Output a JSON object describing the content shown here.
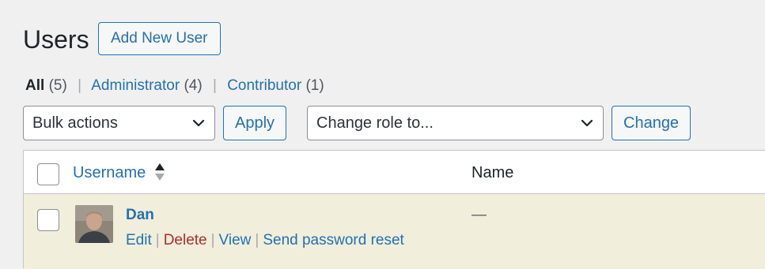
{
  "page": {
    "title": "Users",
    "add_new_label": "Add New User"
  },
  "filters": [
    {
      "label": "All",
      "count": "(5)",
      "current": true
    },
    {
      "label": "Administrator",
      "count": "(4)",
      "current": false
    },
    {
      "label": "Contributor",
      "count": "(1)",
      "current": false
    }
  ],
  "bulk": {
    "select_value": "Bulk actions",
    "apply_label": "Apply"
  },
  "role": {
    "select_value": "Change role to...",
    "change_label": "Change"
  },
  "table": {
    "columns": {
      "username": "Username",
      "name": "Name"
    },
    "rows": [
      {
        "username": "Dan",
        "name": "—",
        "actions": {
          "edit": "Edit",
          "delete": "Delete",
          "view": "View",
          "send_reset": "Send password reset"
        },
        "highlighted": true
      }
    ]
  },
  "colors": {
    "accent": "#2271b1",
    "delete": "#b32d2e",
    "row_highlight": "#f1eedc",
    "background": "#f0f0f1"
  },
  "icons": {
    "sort": "sort-ascending-icon",
    "select_chevron": "chevron-down-icon"
  }
}
